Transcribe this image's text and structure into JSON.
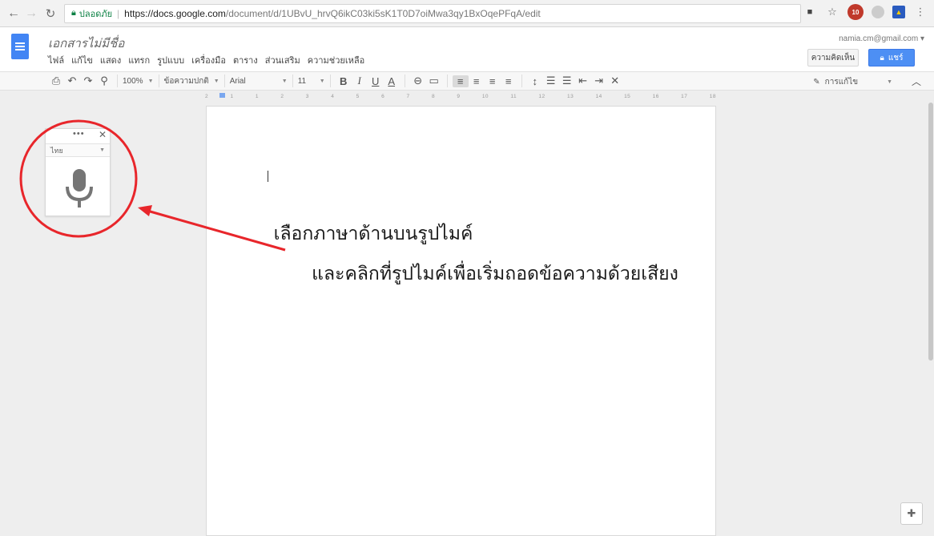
{
  "browser": {
    "secure_label": "ปลอดภัย",
    "url_domain": "https://docs.google.com",
    "url_path": "/document/d/1UBvU_hrvQ6ikC03ki5sK1T0D7oiMwa3qy1BxOqePFqA/edit",
    "badge_count": "10"
  },
  "docs": {
    "title": "เอกสารไม่มีชื่อ",
    "user_email": "namia.cm@gmail.com",
    "comments_label": "ความคิดเห็น",
    "share_label": "แชร์",
    "menu": [
      "ไฟล์",
      "แก้ไข",
      "แสดง",
      "แทรก",
      "รูปแบบ",
      "เครื่องมือ",
      "ตาราง",
      "ส่วนเสริม",
      "ความช่วยเหลือ"
    ]
  },
  "toolbar": {
    "zoom": "100%",
    "style": "ข้อความปกติ",
    "font": "Arial",
    "size": "11",
    "editing_mode": "การแก้ไข"
  },
  "ruler": {
    "ticks": [
      "2",
      "1",
      "1",
      "2",
      "3",
      "4",
      "5",
      "6",
      "7",
      "8",
      "9",
      "10",
      "11",
      "12",
      "13",
      "14",
      "15",
      "16",
      "17",
      "18"
    ]
  },
  "voice_panel": {
    "language": "ไทย"
  },
  "annotation": {
    "line1": "เลือกภาษาด้านบนรูปไมค์",
    "line2": "และคลิกที่รูปไมค์เพื่อเริ่มถอดข้อความด้วยเสียง",
    "color": "#e8262b"
  }
}
